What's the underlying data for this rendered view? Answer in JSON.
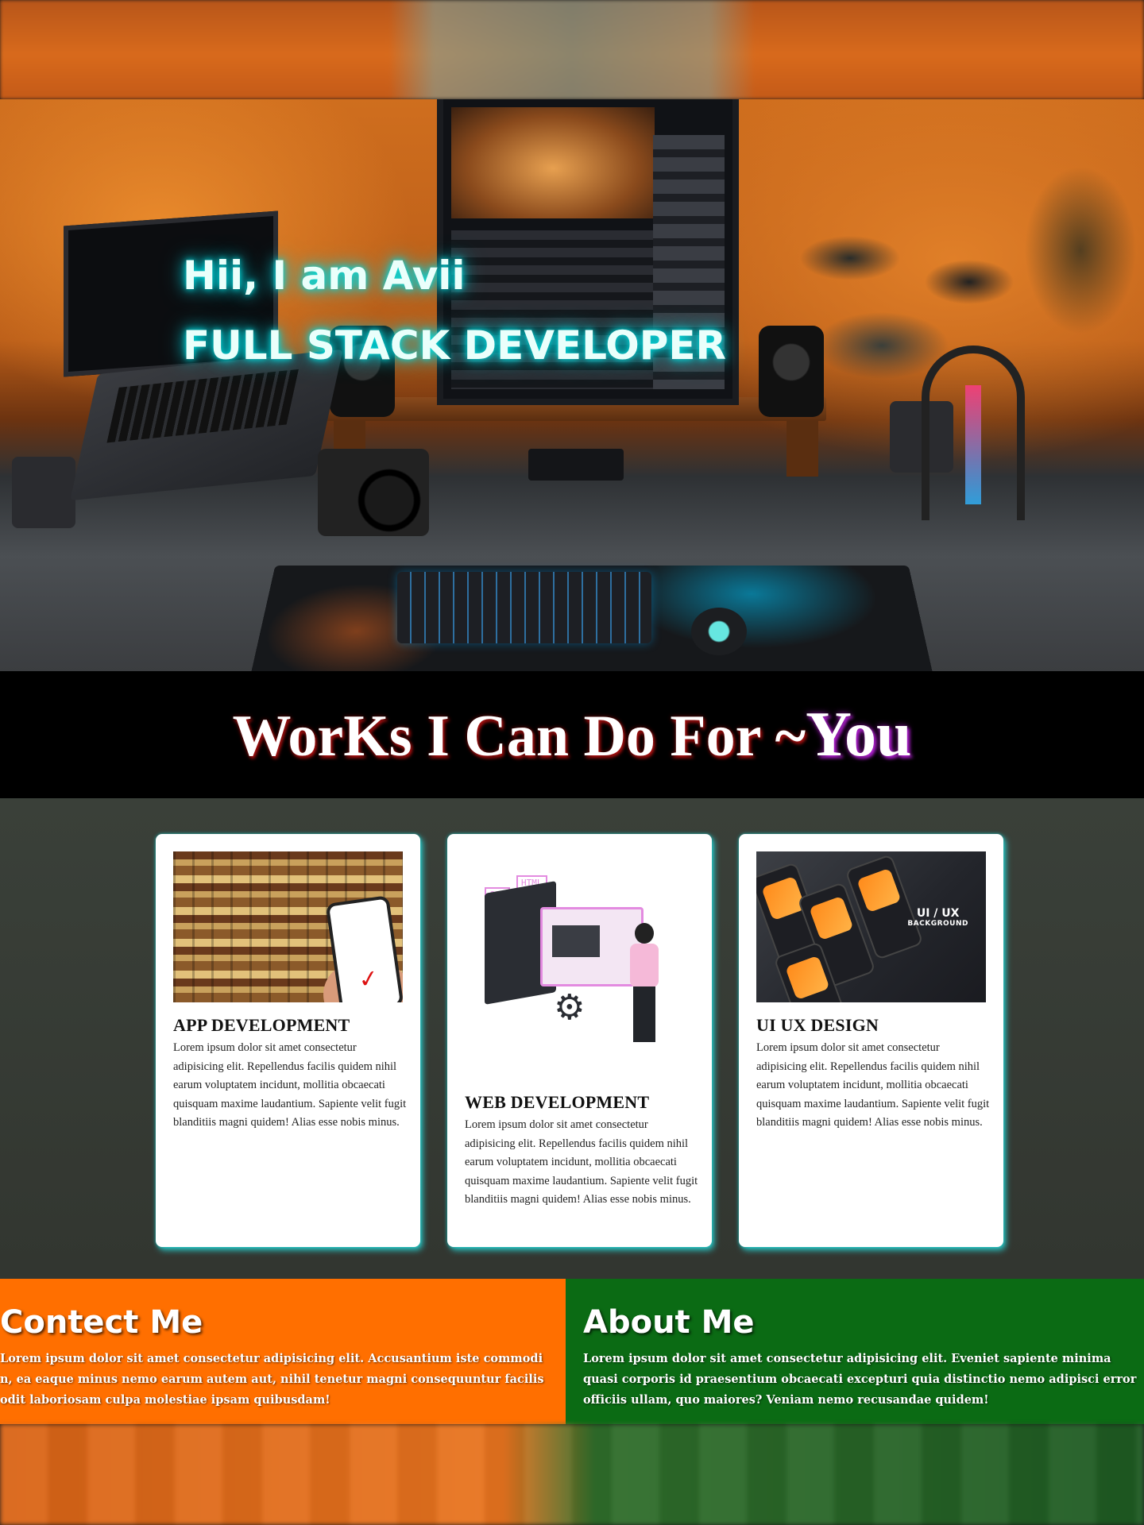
{
  "hero": {
    "greeting": "Hii, I am Avii",
    "role": "FULL STACK DEVELOPER"
  },
  "works": {
    "title": "WorKs I Can Do For ~",
    "highlight": "You"
  },
  "cards": [
    {
      "title": "APP DEVELOPMENT",
      "image_icon": "shopping-app-image",
      "text": "Lorem ipsum dolor sit amet consectetur adipisicing elit. Repellendus facilis quidem nihil earum voluptatem incidunt, mollitia obcaecati quisquam maxime laudantium. Sapiente velit fugit blanditiis magni quidem! Alias esse nobis minus."
    },
    {
      "title": "WEB DEVELOPMENT",
      "image_icon": "web-development-illustration",
      "tags": [
        "CSS",
        "HTML"
      ],
      "text": "Lorem ipsum dolor sit amet consectetur adipisicing elit. Repellendus facilis quidem nihil earum voluptatem incidunt, mollitia obcaecati quisquam maxime laudantium. Sapiente velit fugit blanditiis magni quidem! Alias esse nobis minus."
    },
    {
      "title": "UI UX DESIGN",
      "image_icon": "ui-ux-mockup-image",
      "image_label": "UI / UX",
      "image_sublabel": "BACKGROUND",
      "text": "Lorem ipsum dolor sit amet consectetur adipisicing elit. Repellendus facilis quidem nihil earum voluptatem incidunt, mollitia obcaecati quisquam maxime laudantium. Sapiente velit fugit blanditiis magni quidem! Alias esse nobis minus."
    }
  ],
  "contact": {
    "title": "Contect Me",
    "text": "Lorem ipsum dolor sit amet consectetur adipisicing elit. Accusantium iste commodi n, ea eaque minus nemo earum autem aut, nihil tenetur magni consequuntur facilis odit laboriosam culpa molestiae ipsam quibusdam!"
  },
  "about": {
    "title": "About Me",
    "text": "Lorem ipsum dolor sit amet consectetur adipisicing elit. Eveniet sapiente minima quasi corporis id praesentium obcaecati excepturi quia distinctio nemo adipisci error officiis ullam, quo maiores? Veniam nemo recusandae quidem!"
  },
  "colors": {
    "hero_glow": "#00e0e0",
    "works_band": "#000000",
    "cards_bg": "#373c35",
    "card_glow": "#28dcdc",
    "contact_bg": "#ff6f00",
    "about_bg": "#0b6b14"
  }
}
